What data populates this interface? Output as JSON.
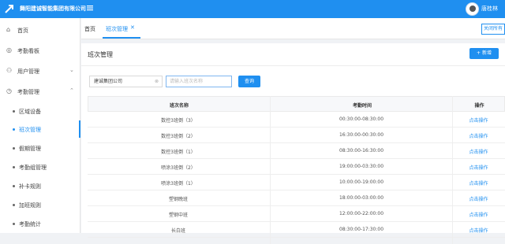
{
  "header": {
    "company": "舞阳建诚智能集团有限公司",
    "user": "唐桂林",
    "collapse_icon": "menu-fold-icon"
  },
  "sidebar": {
    "items": [
      {
        "label": "首页",
        "icon": "home-icon"
      },
      {
        "label": "考勤看板",
        "icon": "dashboard-icon"
      },
      {
        "label": "用户管理",
        "icon": "user-icon"
      },
      {
        "label": "考勤管理",
        "icon": "clock-icon"
      }
    ],
    "subitems": [
      "区域设备",
      "班次管理",
      "假期管理",
      "考勤组管理",
      "补卡规则",
      "加班规则",
      "考勤统计"
    ]
  },
  "tabs": {
    "home": "首页",
    "active": "班次管理",
    "close_all": "关闭所有"
  },
  "panel": {
    "title": "班次管理",
    "add": "+ 新增",
    "company_select": "建诚集团公司",
    "search_placeholder": "请输入班次名称",
    "search": "查询"
  },
  "table": {
    "headers": [
      "班次名称",
      "考勤时间",
      "操作"
    ],
    "rows": [
      [
        "数控3班倒（3）",
        "00:30:00-08:30:00",
        "点击操作"
      ],
      [
        "数控3班倒（2）",
        "16:30:00-00:30:00",
        "点击操作"
      ],
      [
        "数控3班倒（1）",
        "08:30:00-16:30:00",
        "点击操作"
      ],
      [
        "喷涂3班倒（2）",
        "19:00:00-03:30:00",
        "点击操作"
      ],
      [
        "喷涂3班倒（1）",
        "10:00:00-19:00:00",
        "点击操作"
      ],
      [
        "塑钢晚班",
        "18:00:00-03:00:00",
        "点击操作"
      ],
      [
        "塑钢中班",
        "12:00:00-22:00:00",
        "点击操作"
      ],
      [
        "长白班",
        "08:30:00-17:30:00",
        "点击操作"
      ]
    ]
  }
}
